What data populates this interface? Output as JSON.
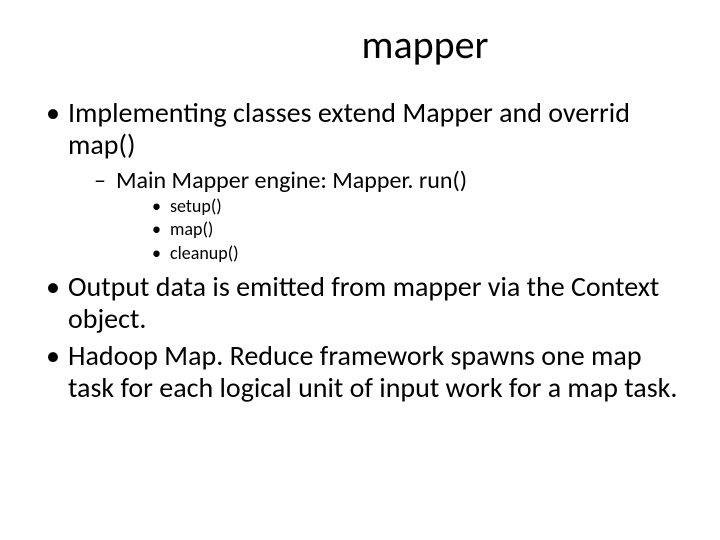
{
  "title": "mapper",
  "bullets": {
    "b1": "Implementing classes extend Mapper and overrid map()",
    "b1_1": "Main Mapper engine: Mapper. run()",
    "b1_1_1": "setup()",
    "b1_1_2": "map()",
    "b1_1_3": "cleanup()",
    "b2": "Output data is emitted from mapper via the Context object.",
    "b3": "Hadoop Map. Reduce framework spawns one map task for each logical unit of input work for a map task."
  }
}
